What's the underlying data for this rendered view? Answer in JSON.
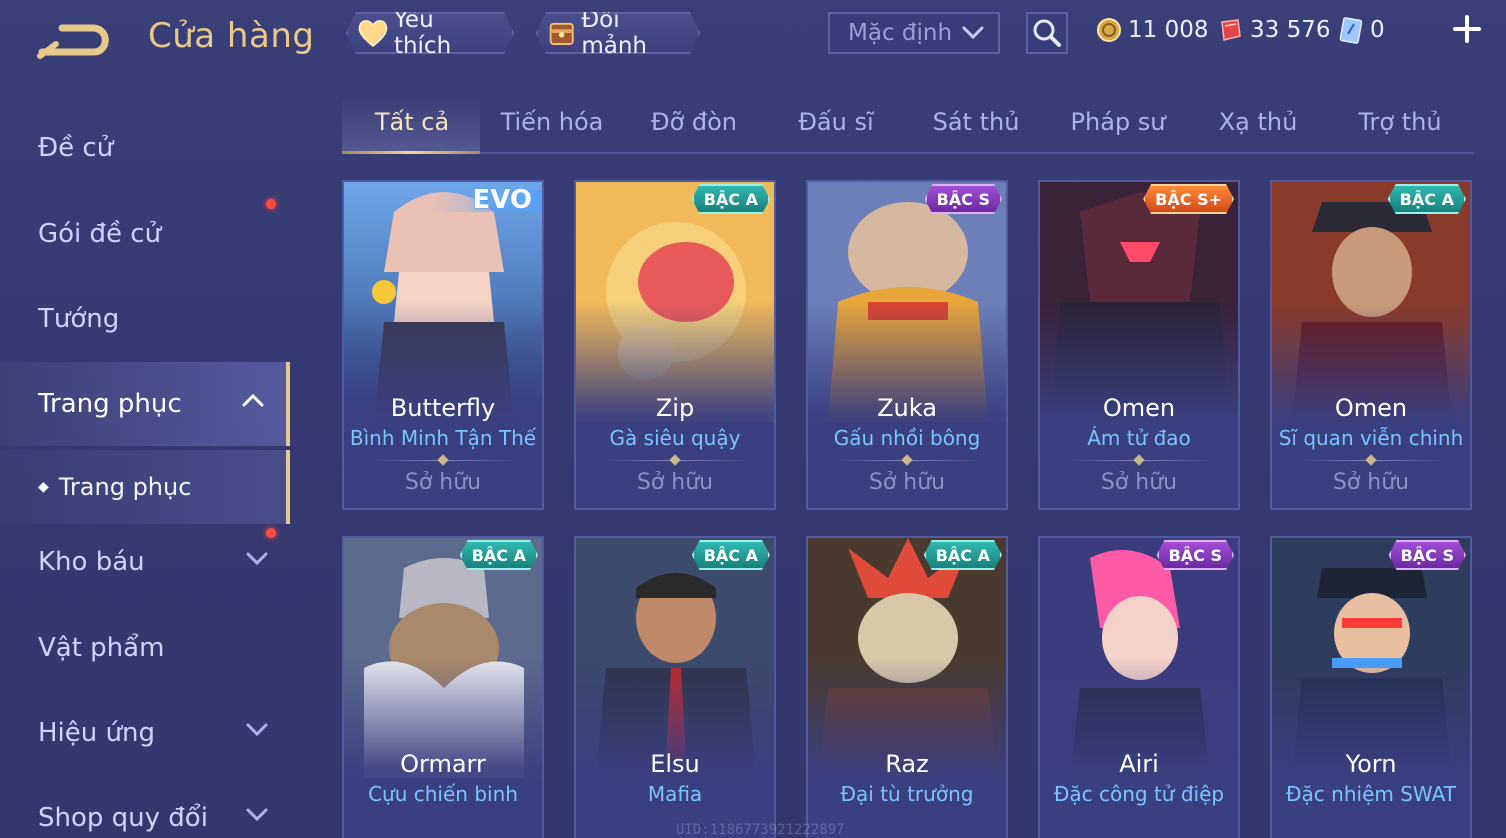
{
  "header": {
    "title": "Cửa hàng",
    "favorites_label": "Yêu thích",
    "exchange_label": "Đổi mảnh",
    "sort": {
      "selected": "Mặc định"
    },
    "currencies": [
      {
        "icon": "gold-coin-icon",
        "value": "11 008"
      },
      {
        "icon": "voucher-gem-icon",
        "value": "33 576"
      },
      {
        "icon": "card-icon",
        "value": "0"
      }
    ]
  },
  "sidebar": {
    "items": [
      {
        "label": "Đề cử"
      },
      {
        "label": "Gói đề cử"
      },
      {
        "label": "Tướng"
      },
      {
        "label": "Trang phục"
      },
      {
        "label": "Kho báu"
      },
      {
        "label": "Vật phẩm"
      },
      {
        "label": "Hiệu ứng"
      },
      {
        "label": "Shop quy đổi"
      }
    ],
    "sub_item": {
      "label": "Trang phục"
    }
  },
  "tabs": [
    {
      "label": "Tất cả"
    },
    {
      "label": "Tiến hóa"
    },
    {
      "label": "Đỡ đòn"
    },
    {
      "label": "Đấu sĩ"
    },
    {
      "label": "Sát thủ"
    },
    {
      "label": "Pháp sư"
    },
    {
      "label": "Xạ thủ"
    },
    {
      "label": "Trợ thủ"
    }
  ],
  "cards": [
    {
      "hero": "Butterfly",
      "skin": "Bình Minh Tận Thế",
      "tier": "EVO",
      "status": "Sở hữu"
    },
    {
      "hero": "Zip",
      "skin": "Gà siêu quậy",
      "tier": "BẬC A",
      "status": "Sở hữu"
    },
    {
      "hero": "Zuka",
      "skin": "Gấu nhồi bông",
      "tier": "BẬC S",
      "status": "Sở hữu"
    },
    {
      "hero": "Omen",
      "skin": "Ám tử đao",
      "tier": "BẬC S+",
      "status": "Sở hữu"
    },
    {
      "hero": "Omen",
      "skin": "Sĩ quan viễn chinh",
      "tier": "BẬC A",
      "status": "Sở hữu"
    },
    {
      "hero": "Ormarr",
      "skin": "Cựu chiến binh",
      "tier": "BẬC A",
      "status": ""
    },
    {
      "hero": "Elsu",
      "skin": "Mafia",
      "tier": "BẬC A",
      "status": ""
    },
    {
      "hero": "Raz",
      "skin": "Đại tù trưởng",
      "tier": "BẬC A",
      "status": ""
    },
    {
      "hero": "Airi",
      "skin": "Đặc công tử điệp",
      "tier": "BẬC S",
      "status": ""
    },
    {
      "hero": "Yorn",
      "skin": "Đặc nhiệm SWAT",
      "tier": "BẬC S",
      "status": ""
    }
  ],
  "watermark": "UID:1186773921222897",
  "colors": {
    "title_gold": "#e7c98a",
    "skin_blue": "#7cc4ff",
    "tier_a": "#18827c",
    "tier_s": "#6c2aa0",
    "tier_s_plus": "#d24a18",
    "notification_red": "#ff4a3d"
  }
}
